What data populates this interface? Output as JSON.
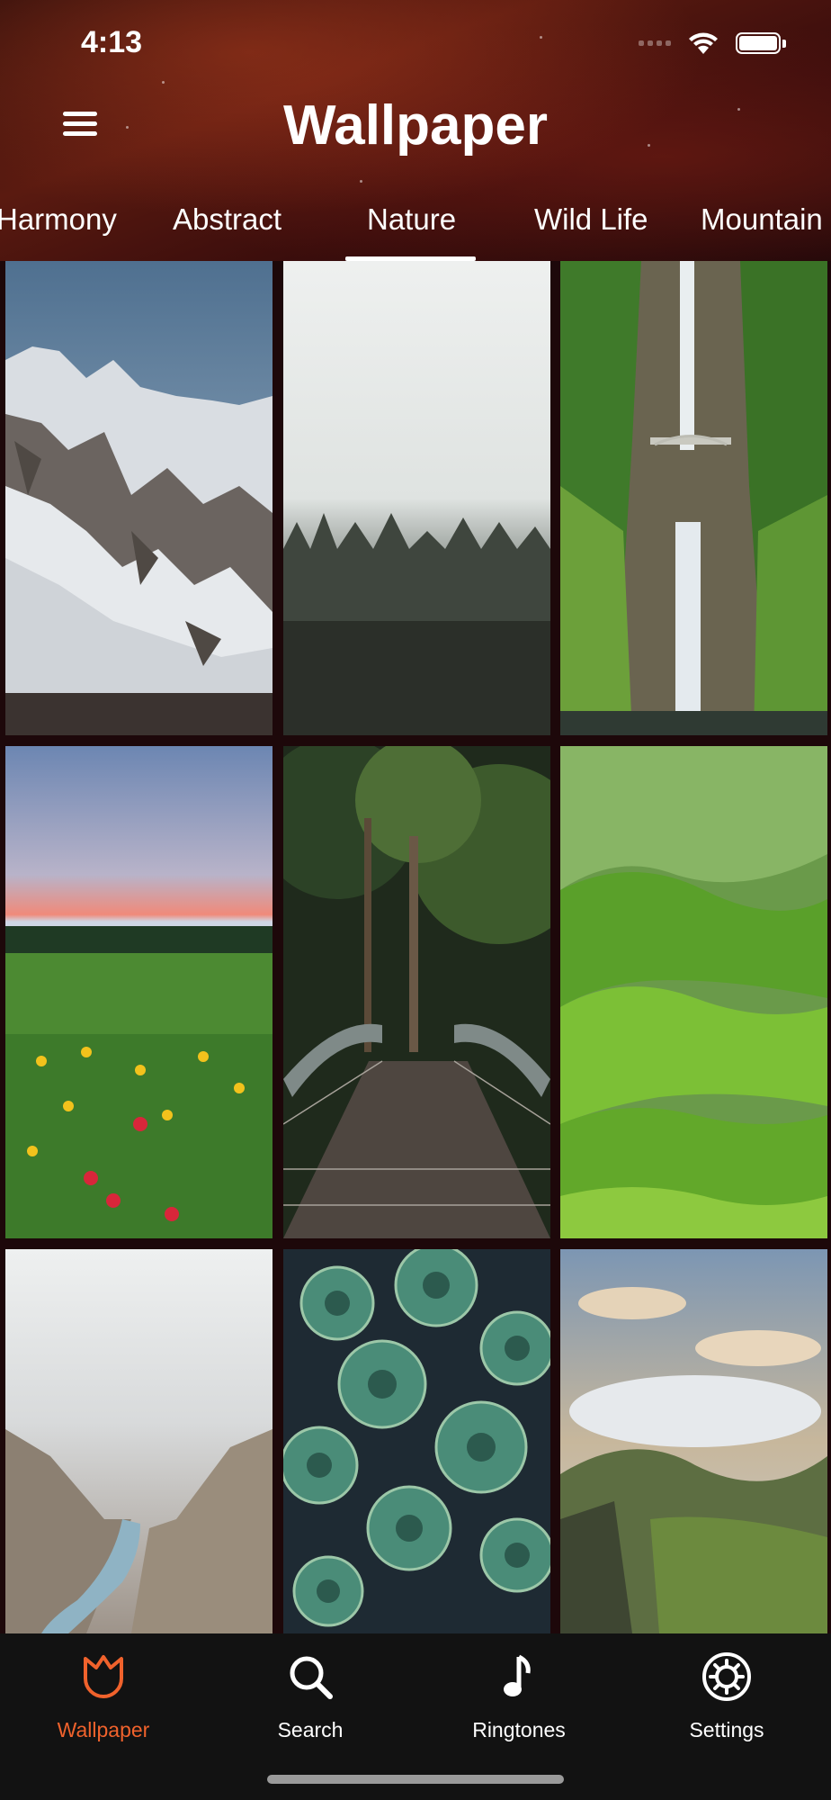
{
  "status": {
    "time": "4:13"
  },
  "header": {
    "title": "Wallpaper"
  },
  "tabs": [
    "Harmony",
    "Abstract",
    "Nature",
    "Wild Life",
    "Mountain"
  ],
  "active_tab": "Nature",
  "wallpapers": [
    {
      "icon": "snowy-mountain-image"
    },
    {
      "icon": "misty-forest-image"
    },
    {
      "icon": "waterfall-bridge-image"
    },
    {
      "icon": "wildflower-meadow-image"
    },
    {
      "icon": "forest-bridge-image"
    },
    {
      "icon": "green-hills-image"
    },
    {
      "icon": "foggy-canyon-image"
    },
    {
      "icon": "succulents-image"
    },
    {
      "icon": "cloudy-valley-image"
    }
  ],
  "tabbar": {
    "items": [
      {
        "label": "Wallpaper",
        "icon": "tulip-icon",
        "active": true
      },
      {
        "label": "Search",
        "icon": "search-icon",
        "active": false
      },
      {
        "label": "Ringtones",
        "icon": "music-note-icon",
        "active": false
      },
      {
        "label": "Settings",
        "icon": "gear-icon",
        "active": false
      }
    ]
  },
  "colors": {
    "accent": "#f0622c",
    "tabbar_bg": "#121212",
    "header_bg": "#4a140e"
  }
}
